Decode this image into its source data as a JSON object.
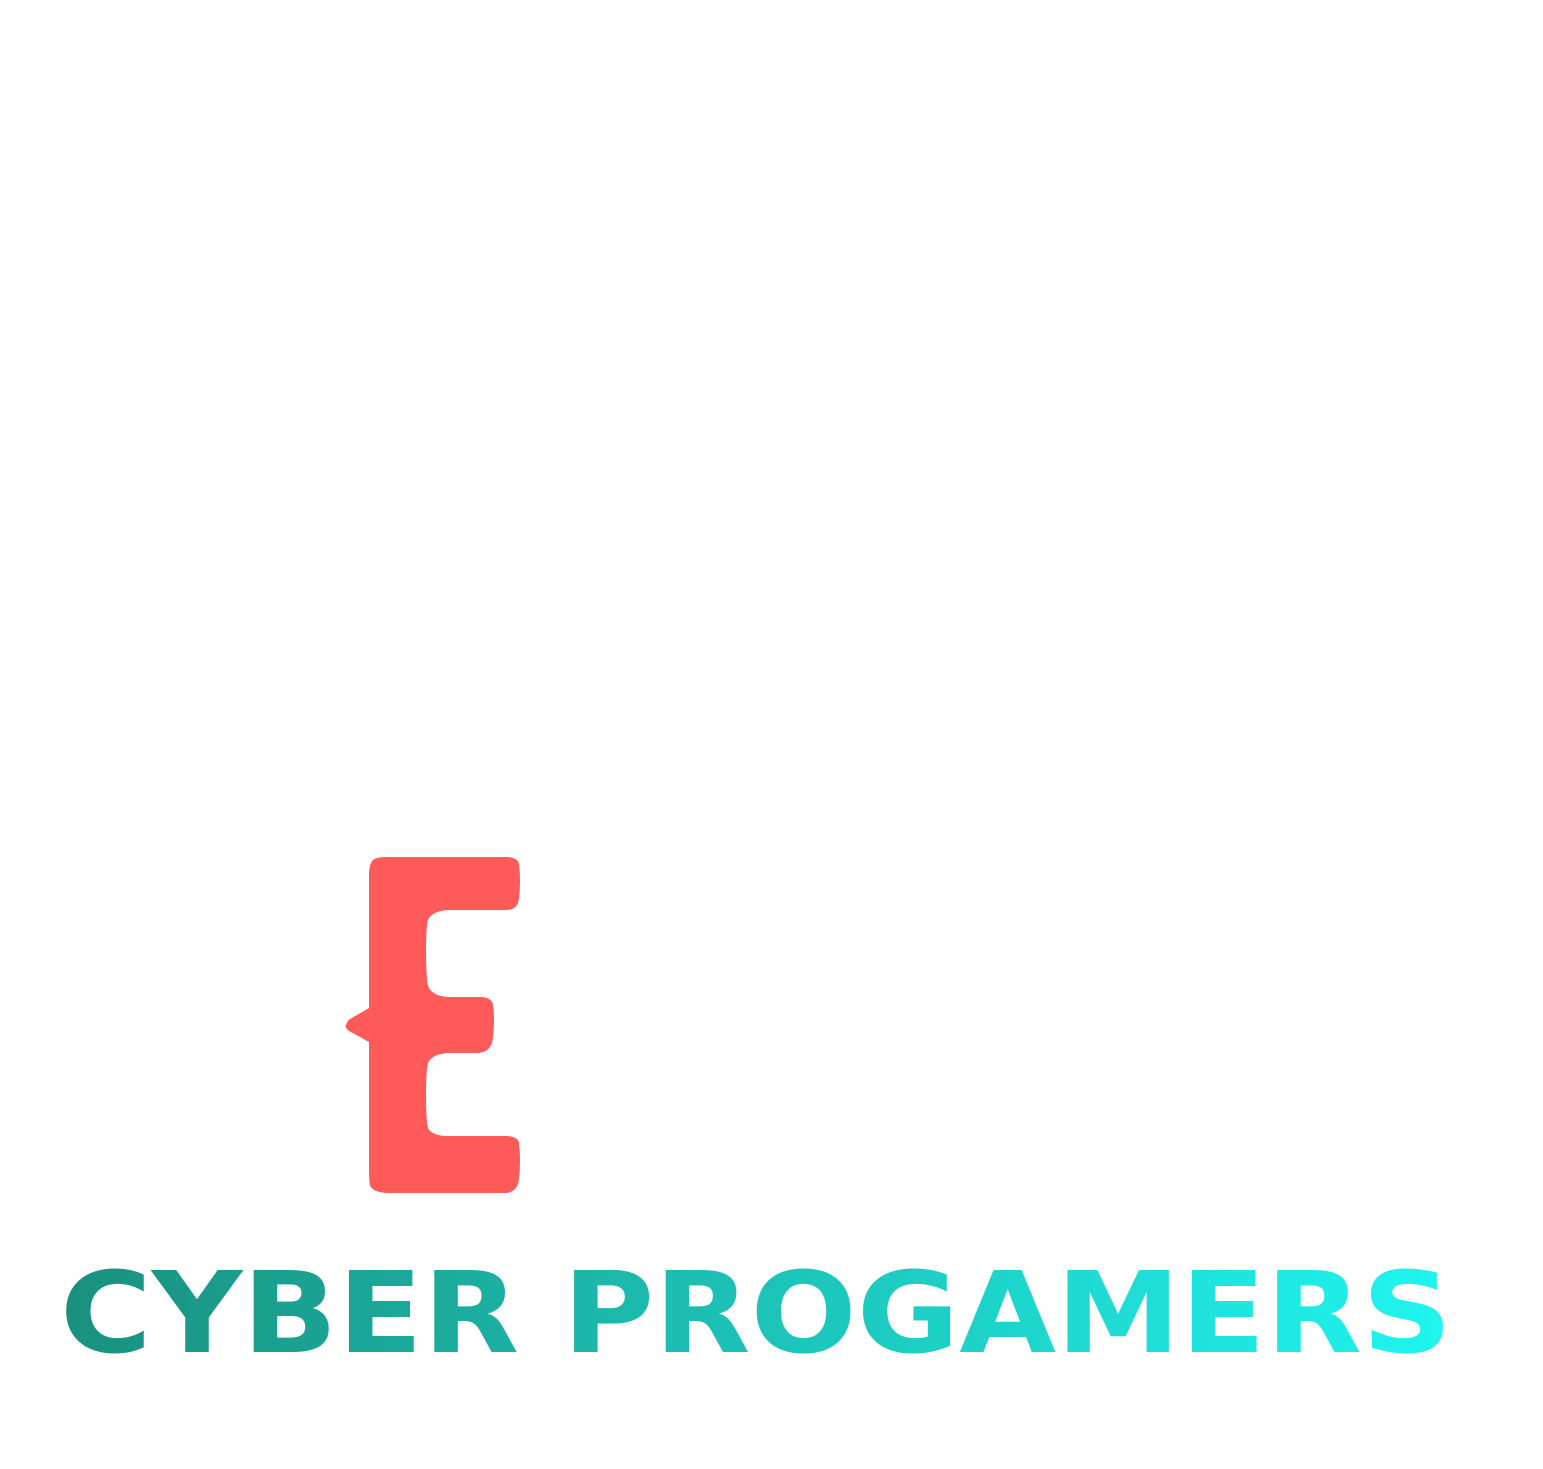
{
  "logo": {
    "tagline": "CYBER PROGAMERS",
    "emblem_color": "#FF5A5A",
    "wordmark_gradient": [
      "#19907E",
      "#1FF5F0"
    ],
    "background": "#FFFFFF"
  }
}
